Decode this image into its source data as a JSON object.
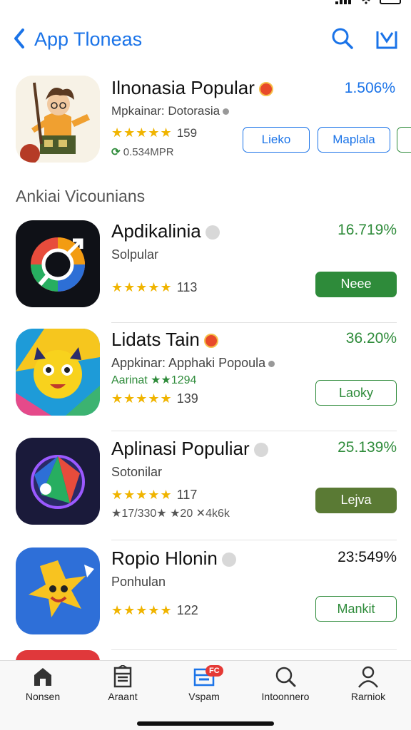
{
  "status": {
    "time": ""
  },
  "nav": {
    "title": "App Tloneas",
    "back_icon": "chevron-left-icon",
    "search_icon": "search-icon",
    "share_icon": "share-icon"
  },
  "featured": {
    "name": "Ilnonasia Popular",
    "percent": "1.506%",
    "subtitle": "Mpkainar: Dotorasia",
    "stars": "★★★★★",
    "rating": "159",
    "size": "0.534MPR",
    "buttons": [
      "Lieko",
      "Maplala"
    ]
  },
  "section_title": "Ankiai Vicounians",
  "apps": [
    {
      "name": "Apdikalinia",
      "percent": "16.719%",
      "subtitle": "Solpular",
      "extra": "",
      "stars": "★★★★★",
      "rating": "113",
      "button": "Neee",
      "button_style": "filled"
    },
    {
      "name": "Lidats Tain",
      "percent": "36.20%",
      "subtitle": "Appkinar: Apphaki Popoula",
      "extra": "Aarinat ★★1294",
      "stars": "★★★★★",
      "rating": "139",
      "button": "Laoky",
      "button_style": "outline"
    },
    {
      "name": "Aplinasi Populiar",
      "percent": "25.139%",
      "subtitle": "Sotonilar",
      "extra": "★17/330★ ★20 ✕4k6k",
      "stars": "★★★★★",
      "rating": "117",
      "button": "Lejva",
      "button_style": "olive"
    },
    {
      "name": "Ropio Hlonin",
      "percent": "23:549%",
      "subtitle": "Ponhulan",
      "extra": "",
      "stars": "★★★★★",
      "rating": "122",
      "button": "Mankit",
      "button_style": "outline"
    }
  ],
  "tabs": [
    {
      "label": "Nonsen",
      "icon": "home-icon"
    },
    {
      "label": "Araant",
      "icon": "apps-icon"
    },
    {
      "label": "Vspam",
      "icon": "games-icon",
      "badge": "FC"
    },
    {
      "label": "Intoonnero",
      "icon": "search-icon"
    },
    {
      "label": "Rarniok",
      "icon": "person-icon"
    }
  ],
  "colors": {
    "accent": "#1a73e8",
    "green": "#2e8b3a",
    "star": "#f0b400"
  }
}
